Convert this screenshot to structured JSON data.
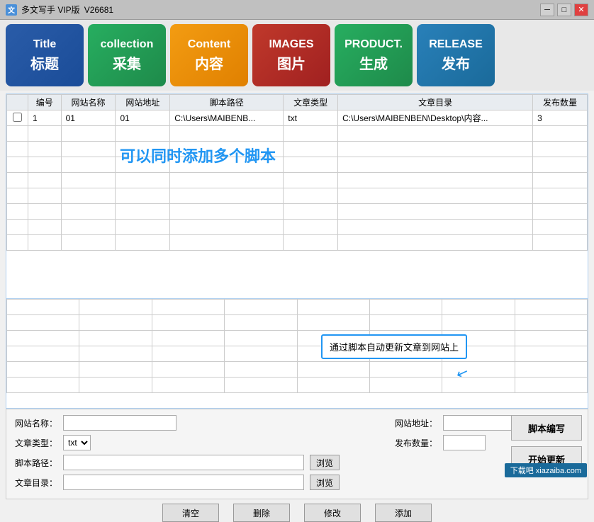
{
  "app": {
    "title": "多文写手 VIP版",
    "version": "V26681"
  },
  "titlebar": {
    "minimize": "─",
    "maximize": "□",
    "close": "✕"
  },
  "nav": {
    "buttons": [
      {
        "id": "title",
        "en": "Title",
        "cn": "标题",
        "class": "btn-title"
      },
      {
        "id": "collection",
        "en": "collection",
        "cn": "采集",
        "class": "btn-collection"
      },
      {
        "id": "content",
        "en": "Content",
        "cn": "内容",
        "class": "btn-content"
      },
      {
        "id": "images",
        "en": "IMAGES",
        "cn": "图片",
        "class": "btn-images"
      },
      {
        "id": "product",
        "en": "PRODUCT.",
        "cn": "生成",
        "class": "btn-product"
      },
      {
        "id": "release",
        "en": "RELEASE",
        "cn": "发布",
        "class": "btn-release"
      }
    ]
  },
  "table": {
    "headers": [
      "编号",
      "网站名称",
      "网站地址",
      "脚本路径",
      "文章类型",
      "文章目录",
      "发布数量"
    ],
    "rows": [
      {
        "num": "1",
        "name": "01",
        "address": "01",
        "script": "C:\\Users\\MAIBENB...",
        "type": "txt",
        "dir": "C:\\Users\\MAIBENBEN\\Desktop\\内容...",
        "count": "3"
      }
    ]
  },
  "overlay_text": "可以同时添加多个脚本",
  "tooltip": {
    "text": "通过脚本自动更新文章到网站上",
    "arrow": "↓"
  },
  "form": {
    "website_name_label": "网站名称：",
    "website_address_label": "网站地址：",
    "article_type_label": "文章类型：",
    "publish_count_label": "发布数量：",
    "script_path_label": "脚本路径：",
    "article_dir_label": "文章目录：",
    "type_options": [
      "txt"
    ],
    "browse_label": "浏览",
    "website_name_value": "",
    "website_address_value": "",
    "article_type_value": "txt",
    "publish_count_value": "",
    "script_path_value": "",
    "article_dir_value": ""
  },
  "buttons": {
    "clear": "清空",
    "delete": "删除",
    "modify": "修改",
    "add": "添加",
    "script_edit": "脚本编写",
    "start_update": "开始更新"
  },
  "watermark": "下载吧 xiazaiba.com"
}
